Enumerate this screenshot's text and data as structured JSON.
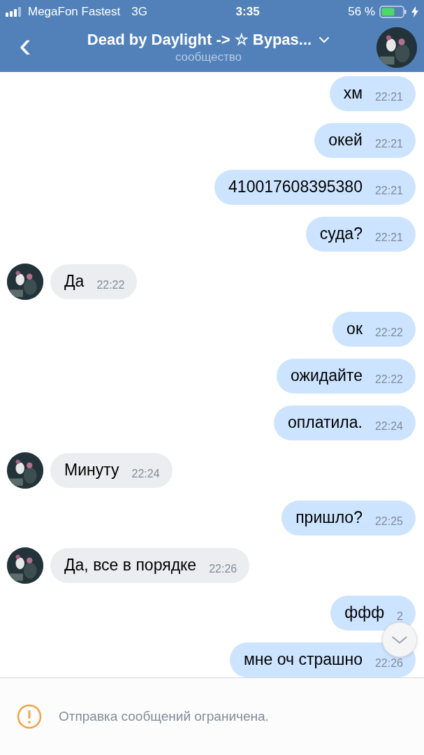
{
  "status_bar": {
    "carrier": "MegaFon Fastest",
    "network": "3G",
    "time": "3:35",
    "battery": "56 %"
  },
  "header": {
    "back": "‹",
    "title": "Dead by Daylight -> ☆ Bypas...",
    "subtitle": "сообщество"
  },
  "messages": [
    {
      "kind": "out",
      "text": "хм",
      "time": "22:21"
    },
    {
      "kind": "out",
      "text": "окей",
      "time": "22:21"
    },
    {
      "kind": "out",
      "text": "410017608395380",
      "time": "22:21"
    },
    {
      "kind": "out",
      "text": "суда?",
      "time": "22:21"
    },
    {
      "kind": "in",
      "text": "Да",
      "time": "22:22"
    },
    {
      "kind": "out",
      "text": "ок",
      "time": "22:22"
    },
    {
      "kind": "out",
      "text": "ожидайте",
      "time": "22:22"
    },
    {
      "kind": "out",
      "text": "оплатила.",
      "time": "22:24"
    },
    {
      "kind": "in",
      "text": "Минуту",
      "time": "22:24"
    },
    {
      "kind": "out",
      "text": "пришло?",
      "time": "22:25"
    },
    {
      "kind": "in",
      "text": "Да, все в порядке",
      "time": "22:26"
    },
    {
      "kind": "out",
      "text": "ффф",
      "time": "2"
    },
    {
      "kind": "out",
      "text": "мне оч страшно",
      "time": "22:26"
    }
  ],
  "footer": {
    "notice": "Отправка сообщений ограничена."
  }
}
